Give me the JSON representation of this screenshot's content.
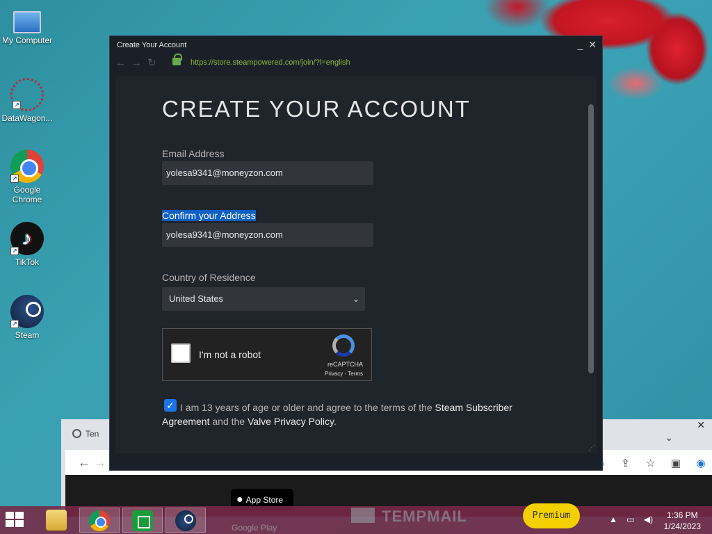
{
  "desktop": {
    "icons": [
      {
        "label": "My Computer"
      },
      {
        "label": "DataWagon..."
      },
      {
        "label": "Google Chrome"
      },
      {
        "label": "TikTok"
      },
      {
        "label": "Steam"
      }
    ]
  },
  "steam_window": {
    "title": "Create Your Account",
    "url": "https://store.steampowered.com/join/?l=english",
    "page_title": "CREATE YOUR ACCOUNT",
    "email_label": "Email Address",
    "email_value": "yolesa9341@moneyzon.com",
    "confirm_label": "Confirm your Address",
    "confirm_value": "yolesa9341@moneyzon.com",
    "country_label": "Country of Residence",
    "country_value": "United States",
    "captcha": {
      "label": "I'm not a robot",
      "brand": "reCAPTCHA",
      "links": "Privacy - Terms"
    },
    "agreement": {
      "checked": true,
      "prefix": "I am 13 years of age or older and agree to the terms of the",
      "link1": "Steam Subscriber Agreement",
      "middle": "and the",
      "link2": "Valve Privacy Policy",
      "suffix": "."
    }
  },
  "background_browser": {
    "tab_label": "Ten",
    "app_store_label": "App Store",
    "google_play_label": "Google Play",
    "tempmail_label": "TEMPMAIL",
    "premium_label": "Premium"
  },
  "taskbar": {
    "time": "1:36 PM",
    "date": "1/24/2023"
  }
}
